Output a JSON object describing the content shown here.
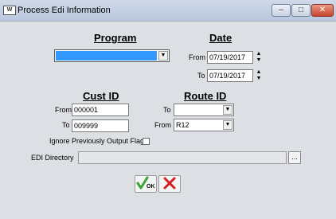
{
  "window": {
    "title": "Process Edi Information",
    "app_icon": "app-icon",
    "controls": {
      "minimize": "minimize-icon",
      "maximize": "maximize-icon",
      "close": "close-icon"
    }
  },
  "program": {
    "title": "Program",
    "selected_value": "",
    "highlight_color": "#3399ff"
  },
  "date": {
    "title": "Date",
    "from_label": "From",
    "from_value": "07/19/2017",
    "to_label": "To",
    "to_value": "07/19/2017"
  },
  "cust_id": {
    "title": "Cust ID",
    "from_label": "From",
    "from_value": "000001",
    "to_label": "To",
    "to_value": "009999"
  },
  "route_id": {
    "title": "Route ID",
    "to_label": "To",
    "to_value": "",
    "from_label": "From",
    "from_value": "R12"
  },
  "options": {
    "ignore_flag_label": "Ignore Previously Output Flag",
    "ignore_flag_checked": false
  },
  "edi_directory": {
    "label": "EDI Directory",
    "value": "",
    "browse_label": "..."
  },
  "actions": {
    "ok_label": "OK",
    "ok_icon": "checkmark-icon",
    "cancel_icon": "red-x-icon"
  }
}
